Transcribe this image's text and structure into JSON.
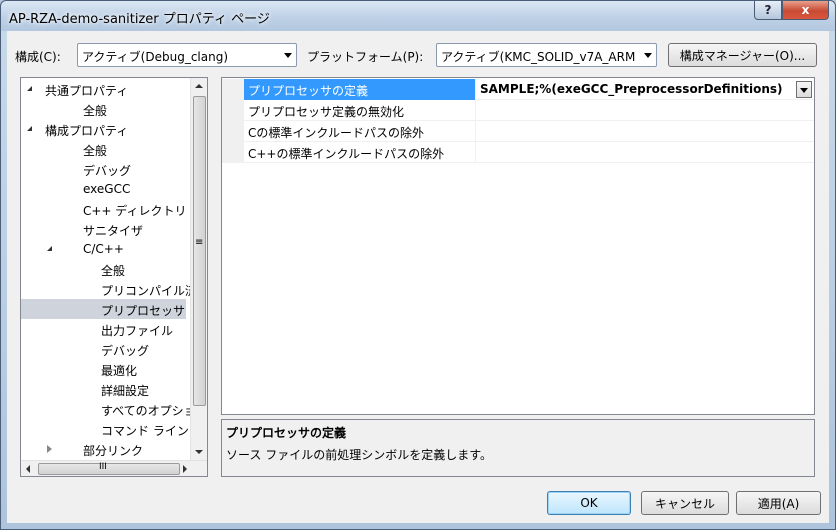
{
  "window": {
    "title": "AP-RZA-demo-sanitizer プロパティ ページ",
    "help_label": "?",
    "close_label": "x"
  },
  "topbar": {
    "config_label": "構成(C):",
    "config_value": "アクティブ(Debug_clang)",
    "platform_label": "プラットフォーム(P):",
    "platform_value": "アクティブ(KMC_SOLID_v7A_ARM",
    "config_manager_label": "構成マネージャー(O)..."
  },
  "tree": {
    "items": [
      {
        "label": "共通プロパティ",
        "level": 0,
        "expander": "open"
      },
      {
        "label": "全般",
        "level": 1,
        "expander": "none"
      },
      {
        "label": "構成プロパティ",
        "level": 0,
        "expander": "open"
      },
      {
        "label": "全般",
        "level": 1,
        "expander": "none"
      },
      {
        "label": "デバッグ",
        "level": 1,
        "expander": "none"
      },
      {
        "label": "exeGCC",
        "level": 1,
        "expander": "none"
      },
      {
        "label": "C++ ディレクトリ",
        "level": 1,
        "expander": "none"
      },
      {
        "label": "サニタイザ",
        "level": 1,
        "expander": "none"
      },
      {
        "label": "C/C++",
        "level": 1,
        "expander": "open"
      },
      {
        "label": "全般",
        "level": 2,
        "expander": "none"
      },
      {
        "label": "プリコンパイル済み",
        "level": 2,
        "expander": "none"
      },
      {
        "label": "プリプロセッサ",
        "level": 2,
        "expander": "none",
        "selected": true
      },
      {
        "label": "出力ファイル",
        "level": 2,
        "expander": "none"
      },
      {
        "label": "デバッグ",
        "level": 2,
        "expander": "none"
      },
      {
        "label": "最適化",
        "level": 2,
        "expander": "none"
      },
      {
        "label": "詳細設定",
        "level": 2,
        "expander": "none"
      },
      {
        "label": "すべてのオプション",
        "level": 2,
        "expander": "none"
      },
      {
        "label": "コマンド ライン",
        "level": 2,
        "expander": "none"
      },
      {
        "label": "部分リンク",
        "level": 1,
        "expander": "closed"
      }
    ],
    "hscroll_grip": "III",
    "vscroll_grip": "≡"
  },
  "grid": {
    "rows": [
      {
        "name": "プリプロセッサの定義",
        "value": "SAMPLE;%(exeGCC_PreprocessorDefinitions)",
        "selected": true
      },
      {
        "name": "プリプロセッサ定義の無効化",
        "value": ""
      },
      {
        "name": "Cの標準インクルードパスの除外",
        "value": ""
      },
      {
        "name": "C++の標準インクルードパスの除外",
        "value": ""
      }
    ]
  },
  "description": {
    "title": "プリプロセッサの定義",
    "text": "ソース ファイルの前処理シンボルを定義します。"
  },
  "buttons": {
    "ok": "OK",
    "cancel": "キャンセル",
    "apply": "適用(A)"
  }
}
